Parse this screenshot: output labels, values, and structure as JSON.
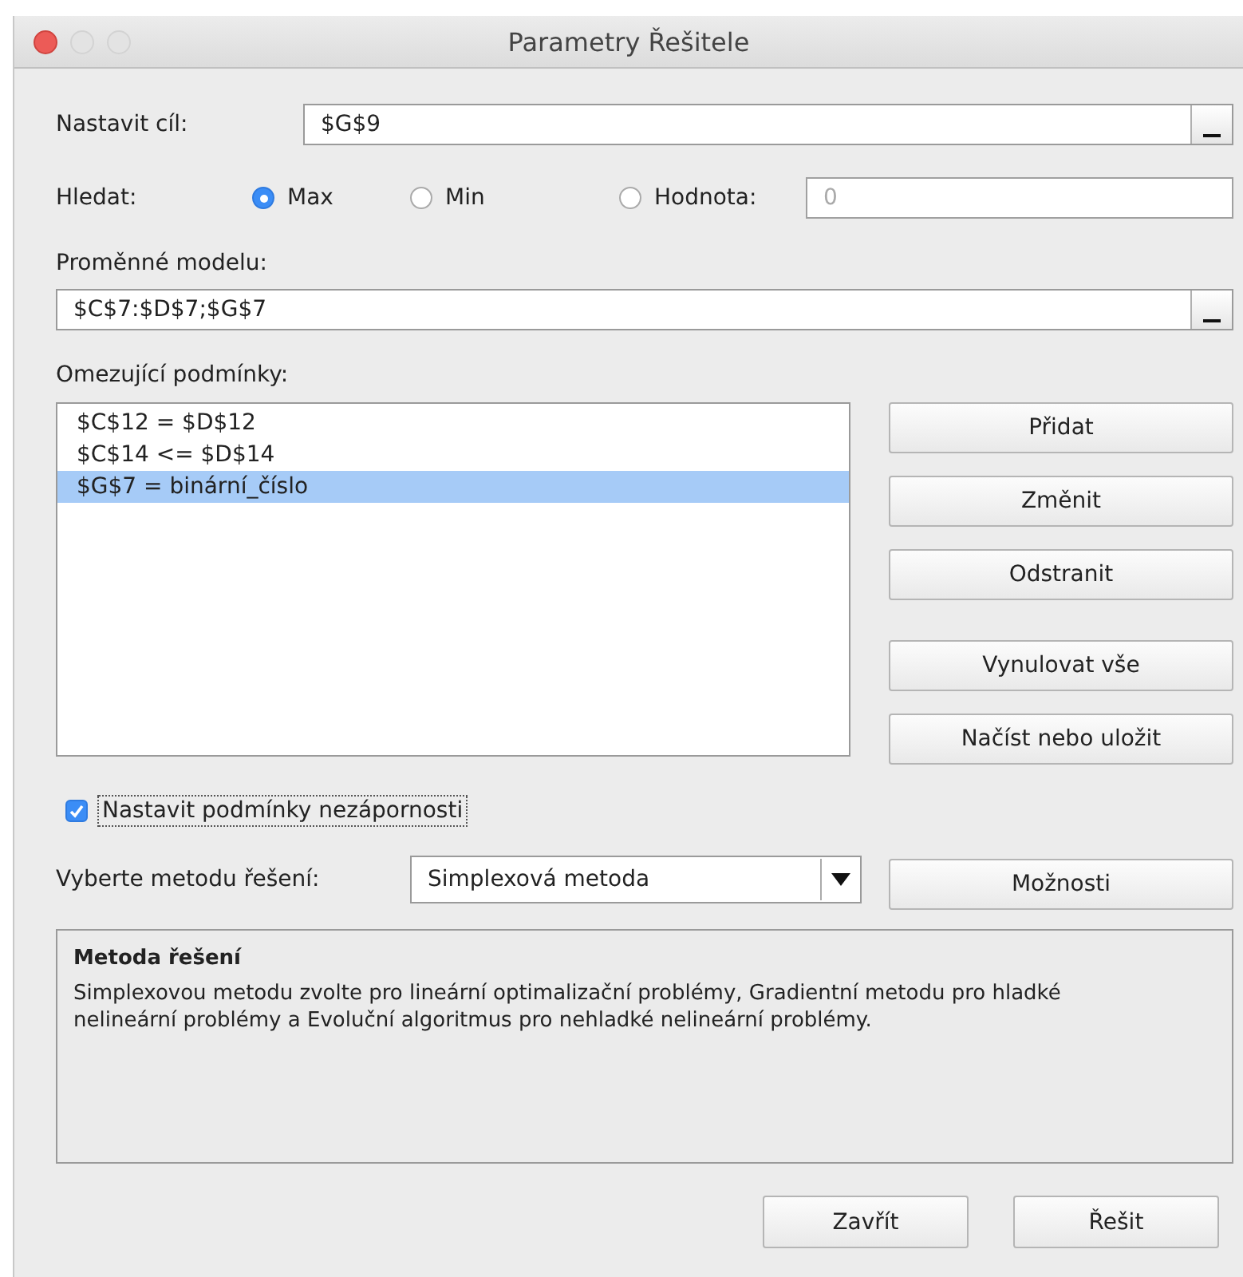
{
  "window": {
    "title": "Parametry Řešitele"
  },
  "objective": {
    "label": "Nastavit cíl:",
    "value": "$G$9"
  },
  "search": {
    "label": "Hledat:",
    "options": [
      {
        "label": "Max",
        "selected": true
      },
      {
        "label": "Min",
        "selected": false
      },
      {
        "label": "Hodnota:",
        "selected": false
      }
    ],
    "value_field": {
      "value": "0",
      "disabled": true
    }
  },
  "variables": {
    "label": "Proměnné modelu:",
    "value": "$C$7:$D$7;$G$7"
  },
  "constraints": {
    "label": "Omezující podmínky:",
    "items": [
      {
        "text": "$C$12 = $D$12",
        "selected": false
      },
      {
        "text": "$C$14 <= $D$14",
        "selected": false
      },
      {
        "text": "$G$7 = binární_číslo",
        "selected": true
      }
    ],
    "buttons": [
      "Přidat",
      "Změnit",
      "Odstranit",
      "Vynulovat vše",
      "Načíst nebo uložit"
    ]
  },
  "nonnegative": {
    "label": "Nastavit podmínky nezápornosti",
    "checked": true
  },
  "method": {
    "label": "Vyberte metodu řešení:",
    "value": "Simplexová metoda",
    "button": "Možnosti"
  },
  "description": {
    "title": "Metoda řešení",
    "text": "Simplexovou metodu zvolte pro lineární optimalizační problémy, Gradientní metodu pro hladké nelineární problémy a Evoluční algoritmus pro nehladké nelineární problémy."
  },
  "footer_buttons": [
    "Zavřít",
    "Řešit"
  ]
}
